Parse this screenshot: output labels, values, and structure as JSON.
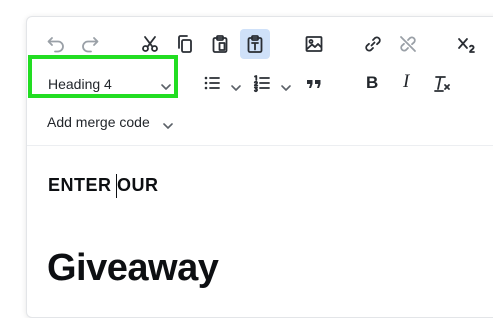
{
  "toolbar": {
    "heading_value": "Heading 4",
    "merge_code_label": "Add merge code",
    "buttons": {
      "undo": "undo-icon",
      "redo": "redo-icon",
      "cut": "scissors-icon",
      "copy": "copy-icon",
      "paste": "clipboard-icon",
      "paste_as_text": "paste-text-icon",
      "insert_image": "image-icon",
      "insert_link": "link-icon",
      "unlink": "unlink-icon",
      "subscript": "subscript-icon",
      "bulleted_list": "bulleted-list-icon",
      "numbered_list": "numbered-list-icon",
      "blockquote": "quote-icon",
      "bold": "bold-icon",
      "italic": "italic-icon",
      "clear_format": "clear-format-icon"
    },
    "bold_label": "B",
    "italic_label": "I"
  },
  "content": {
    "heading4_text": "ENTER OUR",
    "heading1_text": "Giveaway"
  },
  "colors": {
    "active_button_bg": "#cfe1f9",
    "highlight_border": "#22dd22",
    "text": "#0d0f12"
  }
}
